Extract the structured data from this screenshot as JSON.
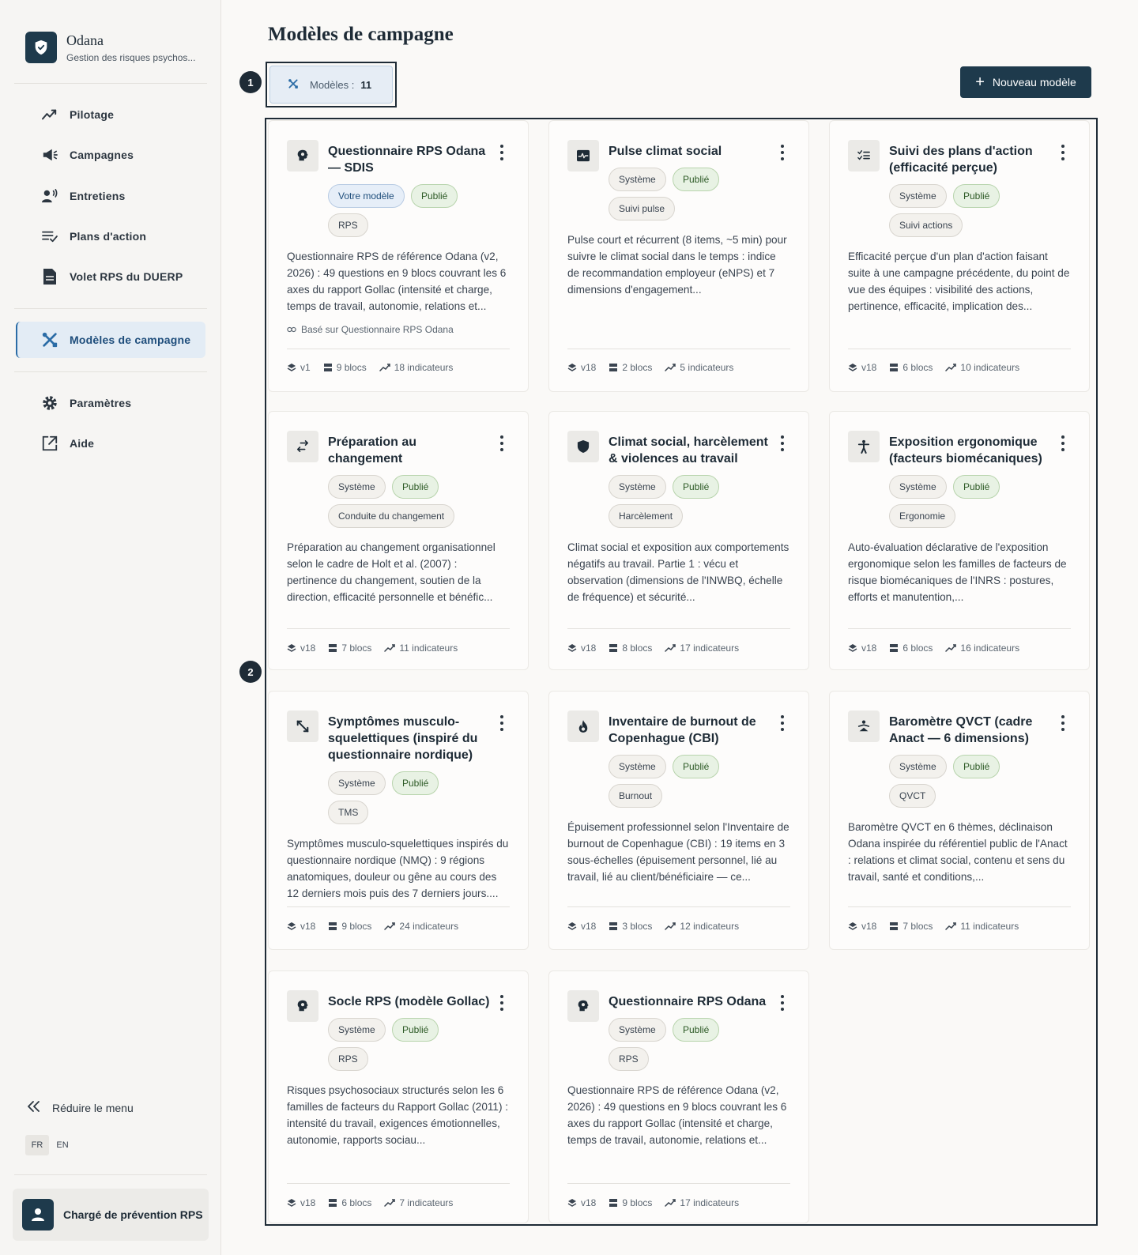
{
  "brand": {
    "name": "Odana",
    "subtitle": "Gestion des risques psychos..."
  },
  "nav": {
    "items": [
      {
        "label": "Pilotage",
        "icon": "trend-icon"
      },
      {
        "label": "Campagnes",
        "icon": "megaphone-icon"
      },
      {
        "label": "Entretiens",
        "icon": "speaking-person-icon"
      },
      {
        "label": "Plans d'action",
        "icon": "checklist-icon"
      },
      {
        "label": "Volet RPS du DUERP",
        "icon": "document-icon"
      },
      {
        "label": "Modèles de campagne",
        "icon": "tools-icon",
        "active": true
      },
      {
        "label": "Paramètres",
        "icon": "gear-icon"
      },
      {
        "label": "Aide",
        "icon": "external-link-icon"
      }
    ],
    "collapse_label": "Réduire le menu",
    "languages": [
      "FR",
      "EN"
    ],
    "active_language": "FR"
  },
  "user": {
    "role": "Chargé de prévention RPS"
  },
  "main": {
    "title": "Modèles de campagne",
    "count_label": "Modèles :",
    "count_value": "11",
    "new_button": "Nouveau modèle",
    "markers": [
      "1",
      "2"
    ]
  },
  "cards": [
    {
      "title": "Questionnaire RPS Odana — SDIS",
      "icon": "brain-icon",
      "chips": [
        "Votre modèle",
        "Publié"
      ],
      "chip_styles": [
        "blue",
        "green"
      ],
      "category": "RPS",
      "description": "Questionnaire RPS de référence Odana (v2, 2026) : 49 questions en 9 blocs couvrant les 6 axes du rapport Gollac (intensité et charge, temps de travail, autonomie, relations et...",
      "based_on": "Basé sur Questionnaire RPS Odana",
      "version": "v1",
      "blocks": "9 blocs",
      "indicators": "18 indicateurs"
    },
    {
      "title": "Pulse climat social",
      "icon": "pulse-icon",
      "chips": [
        "Système",
        "Publié"
      ],
      "chip_styles": [
        "grey",
        "green"
      ],
      "category": "Suivi pulse",
      "description": "Pulse court et récurrent (8 items, ~5 min) pour suivre le climat social dans le temps : indice de recommandation employeur (eNPS) et 7 dimensions d'engagement...",
      "version": "v18",
      "blocks": "2 blocs",
      "indicators": "5 indicateurs"
    },
    {
      "title": "Suivi des plans d'action (efficacité perçue)",
      "icon": "checklist-icon",
      "chips": [
        "Système",
        "Publié"
      ],
      "chip_styles": [
        "grey",
        "green"
      ],
      "category": "Suivi actions",
      "description": "Efficacité perçue d'un plan d'action faisant suite à une campagne précédente, du point de vue des équipes : visibilité des actions, pertinence, efficacité, implication des...",
      "version": "v18",
      "blocks": "6 blocs",
      "indicators": "10 indicateurs"
    },
    {
      "title": "Préparation au changement",
      "icon": "swap-icon",
      "chips": [
        "Système",
        "Publié"
      ],
      "chip_styles": [
        "grey",
        "green"
      ],
      "category": "Conduite du changement",
      "description": "Préparation au changement organisationnel selon le cadre de Holt et al. (2007) : pertinence du changement, soutien de la direction, efficacité personnelle et bénéfic...",
      "version": "v18",
      "blocks": "7 blocs",
      "indicators": "11 indicateurs"
    },
    {
      "title": "Climat social, harcèlement & violences au travail",
      "icon": "shield-icon",
      "chips": [
        "Système",
        "Publié"
      ],
      "chip_styles": [
        "grey",
        "green"
      ],
      "category": "Harcèlement",
      "description": "Climat social et exposition aux comportements négatifs au travail. Partie 1 : vécu et observation (dimensions de l'INWBQ, échelle de fréquence) et sécurité...",
      "version": "v18",
      "blocks": "8 blocs",
      "indicators": "17 indicateurs"
    },
    {
      "title": "Exposition ergonomique (facteurs biomécaniques)",
      "icon": "person-icon",
      "chips": [
        "Système",
        "Publié"
      ],
      "chip_styles": [
        "grey",
        "green"
      ],
      "category": "Ergonomie",
      "description": "Auto-évaluation déclarative de l'exposition ergonomique selon les familles de facteurs de risque biomécaniques de l'INRS : postures, efforts et manutention,...",
      "version": "v18",
      "blocks": "6 blocs",
      "indicators": "16 indicateurs"
    },
    {
      "title": "Symptômes musculo-squelettiques (inspiré du questionnaire nordique)",
      "icon": "stretch-icon",
      "chips": [
        "Système",
        "Publié"
      ],
      "chip_styles": [
        "grey",
        "green"
      ],
      "category": "TMS",
      "description": "Symptômes musculo-squelettiques inspirés du questionnaire nordique (NMQ) : 9 régions anatomiques, douleur ou gêne au cours des 12 derniers mois puis des 7 derniers jours....",
      "version": "v18",
      "blocks": "9 blocs",
      "indicators": "24 indicateurs"
    },
    {
      "title": "Inventaire de burnout de Copenhague (CBI)",
      "icon": "flame-icon",
      "chips": [
        "Système",
        "Publié"
      ],
      "chip_styles": [
        "grey",
        "green"
      ],
      "category": "Burnout",
      "description": "Épuisement professionnel selon l'Inventaire de burnout de Copenhague (CBI) : 19 items en 3 sous-échelles (épuisement personnel, lié au travail, lié au client/bénéficiaire — ce...",
      "version": "v18",
      "blocks": "3 blocs",
      "indicators": "12 indicateurs"
    },
    {
      "title": "Baromètre QVCT (cadre Anact — 6 dimensions)",
      "icon": "wellbeing-icon",
      "chips": [
        "Système",
        "Publié"
      ],
      "chip_styles": [
        "grey",
        "green"
      ],
      "category": "QVCT",
      "description": "Baromètre QVCT en 6 thèmes, déclinaison Odana inspirée du référentiel public de l'Anact : relations et climat social, contenu et sens du travail, santé et conditions,...",
      "version": "v18",
      "blocks": "7 blocs",
      "indicators": "11 indicateurs"
    },
    {
      "title": "Socle RPS (modèle Gollac)",
      "icon": "brain-icon",
      "chips": [
        "Système",
        "Publié"
      ],
      "chip_styles": [
        "grey",
        "green"
      ],
      "category": "RPS",
      "description": "Risques psychosociaux structurés selon les 6 familles de facteurs du Rapport Gollac (2011) : intensité du travail, exigences émotionnelles, autonomie, rapports sociau...",
      "version": "v18",
      "blocks": "6 blocs",
      "indicators": "7 indicateurs"
    },
    {
      "title": "Questionnaire RPS Odana",
      "icon": "brain-icon",
      "chips": [
        "Système",
        "Publié"
      ],
      "chip_styles": [
        "grey",
        "green"
      ],
      "category": "RPS",
      "description": "Questionnaire RPS de référence Odana (v2, 2026) : 49 questions en 9 blocs couvrant les 6 axes du rapport Gollac (intensité et charge, temps de travail, autonomie, relations et...",
      "version": "v18",
      "blocks": "9 blocs",
      "indicators": "17 indicateurs"
    }
  ]
}
